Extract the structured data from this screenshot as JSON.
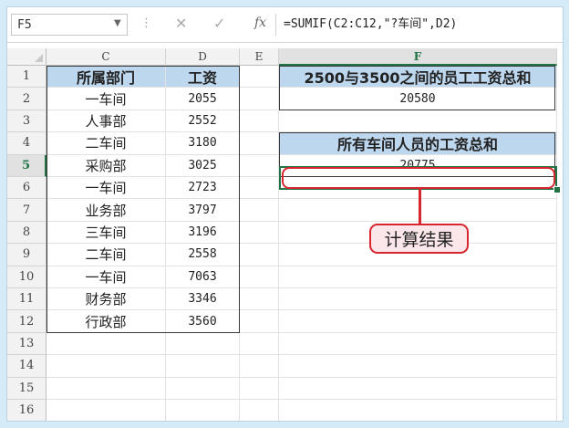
{
  "formula_bar": {
    "name_box": "F5",
    "formula": "=SUMIF(C2:C12,\"?车间\",D2)",
    "cancel_glyph": "✕",
    "enter_glyph": "✓",
    "fx_label": "fx"
  },
  "columns": [
    "C",
    "D",
    "E",
    "F"
  ],
  "active_column": "F",
  "active_row": 5,
  "rows": [
    {
      "num": "1",
      "c": "所属部门",
      "d": "工资",
      "f": "2500与3500之间的员工工资总和"
    },
    {
      "num": "2",
      "c": "一车间",
      "d": "2055",
      "f": "20580"
    },
    {
      "num": "3",
      "c": "人事部",
      "d": "2552",
      "f": ""
    },
    {
      "num": "4",
      "c": "二车间",
      "d": "3180",
      "f": "所有车间人员的工资总和"
    },
    {
      "num": "5",
      "c": "采购部",
      "d": "3025",
      "f": "20775"
    },
    {
      "num": "6",
      "c": "一车间",
      "d": "2723",
      "f": ""
    },
    {
      "num": "7",
      "c": "业务部",
      "d": "3797",
      "f": ""
    },
    {
      "num": "8",
      "c": "三车间",
      "d": "3196",
      "f": ""
    },
    {
      "num": "9",
      "c": "二车间",
      "d": "2558",
      "f": ""
    },
    {
      "num": "10",
      "c": "一车间",
      "d": "7063",
      "f": ""
    },
    {
      "num": "11",
      "c": "财务部",
      "d": "3346",
      "f": ""
    },
    {
      "num": "12",
      "c": "行政部",
      "d": "3560",
      "f": ""
    },
    {
      "num": "13",
      "c": "",
      "d": "",
      "f": ""
    },
    {
      "num": "14",
      "c": "",
      "d": "",
      "f": ""
    },
    {
      "num": "15",
      "c": "",
      "d": "",
      "f": ""
    },
    {
      "num": "16",
      "c": "",
      "d": "",
      "f": ""
    }
  ],
  "callout": {
    "label": "计算结果"
  },
  "colors": {
    "accent_green": "#217346",
    "header_fill": "#bdd7ee",
    "highlight_red": "#d7262f",
    "callout_fill": "#fbe6ea"
  }
}
